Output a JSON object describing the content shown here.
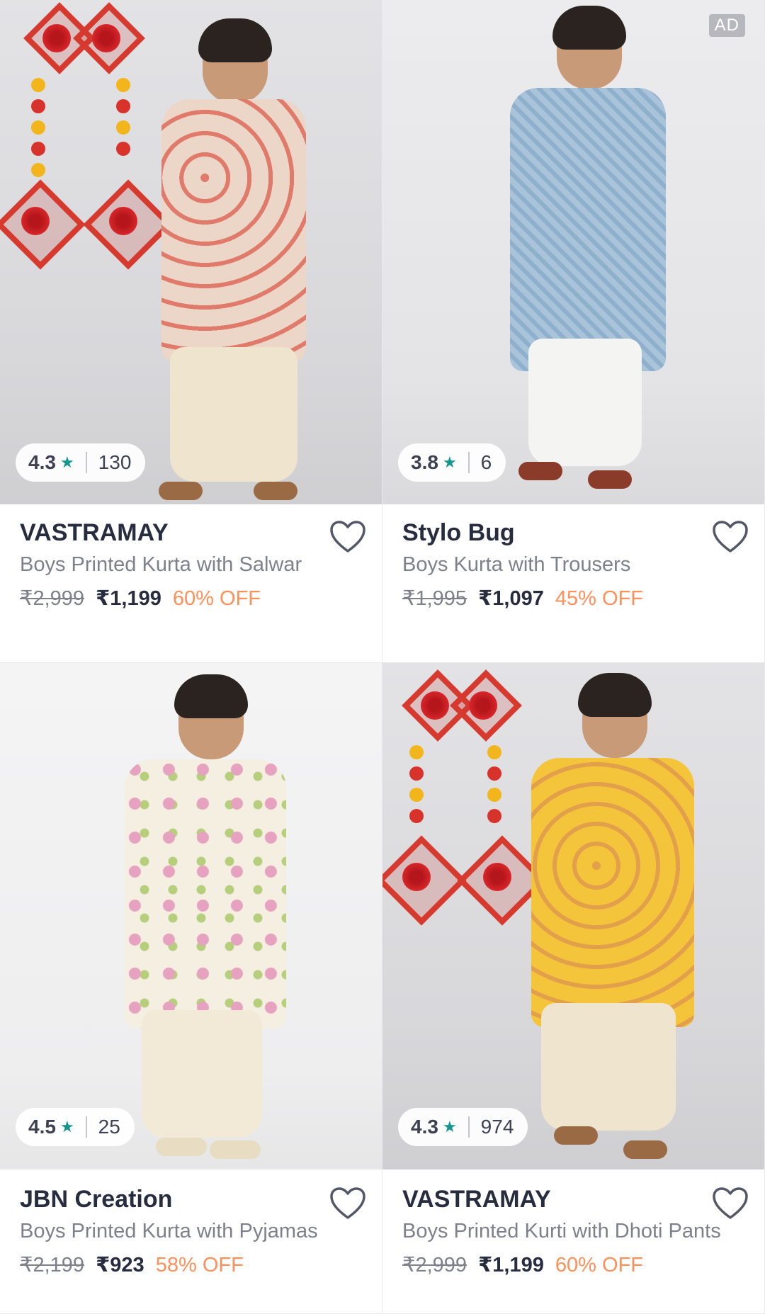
{
  "products": [
    {
      "brand": "VASTRAMAY",
      "title": "Boys Printed Kurta with Salwar",
      "mrp": "₹2,999",
      "price": "₹1,199",
      "discount": "60% OFF",
      "rating": "4.3",
      "rating_count": "130",
      "ad": ""
    },
    {
      "brand": "Stylo Bug",
      "title": "Boys Kurta with Trousers",
      "mrp": "₹1,995",
      "price": "₹1,097",
      "discount": "45% OFF",
      "rating": "3.8",
      "rating_count": "6",
      "ad": "AD"
    },
    {
      "brand": "JBN Creation",
      "title": "Boys Printed Kurta with Pyjamas",
      "mrp": "₹2,199",
      "price": "₹923",
      "discount": "58% OFF",
      "rating": "4.5",
      "rating_count": "25",
      "ad": ""
    },
    {
      "brand": "VASTRAMAY",
      "title": "Boys Printed Kurti with Dhoti Pants",
      "mrp": "₹2,999",
      "price": "₹1,199",
      "discount": "60% OFF",
      "rating": "4.3",
      "rating_count": "974",
      "ad": ""
    }
  ],
  "icons": {
    "rating_star": "★",
    "wishlist": "heart-outline-icon"
  },
  "colors": {
    "star": "#14958f",
    "discount": "#ff905a",
    "brand_text": "#282c3f",
    "muted_text": "#7e818c"
  }
}
